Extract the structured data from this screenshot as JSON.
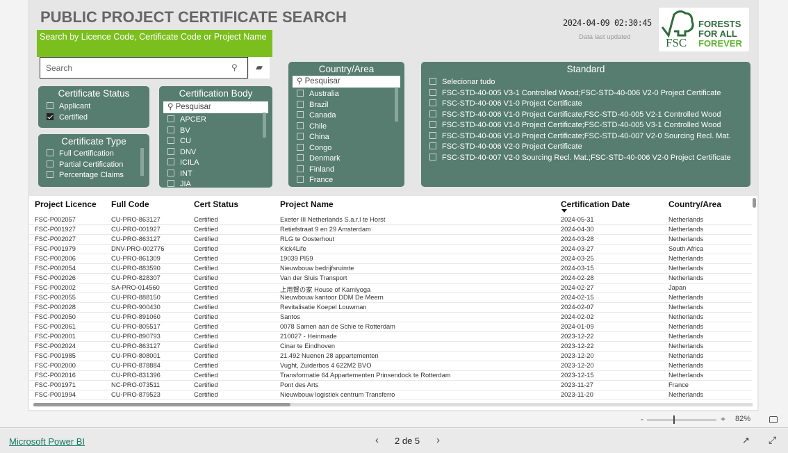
{
  "header": {
    "title": "PUBLIC PROJECT CERTIFICATE SEARCH",
    "search_label": "Search by Licence Code, Certificate Code or Project Name",
    "search_placeholder": "Search",
    "timestamp": "2024-04-09 02:30:45",
    "timestamp_label": "Data last updated",
    "logo": {
      "text1": "FORESTS",
      "text2": "FOR ALL",
      "text3": "FOREVER",
      "brand": "FSC",
      "tm": "™"
    }
  },
  "filters": {
    "cert_status": {
      "title": "Certificate Status",
      "items": [
        {
          "label": "Applicant",
          "checked": false
        },
        {
          "label": "Certified",
          "checked": true
        }
      ]
    },
    "cert_type": {
      "title": "Certificate Type",
      "items": [
        "Full Certification",
        "Partial Certification",
        "Percentage Claims"
      ]
    },
    "cert_body": {
      "title": "Certification Body",
      "search": "Pesquisar",
      "items": [
        "APCER",
        "BV",
        "CU",
        "DNV",
        "ICILA",
        "INT",
        "JIA"
      ]
    },
    "country": {
      "title": "Country/Area",
      "search": "Pesquisar",
      "items": [
        "Australia",
        "Brazil",
        "Canada",
        "Chile",
        "China",
        "Congo",
        "Denmark",
        "Finland",
        "France"
      ]
    },
    "standard": {
      "title": "Standard",
      "items": [
        "Selecionar tudo",
        "FSC-STD-40-005 V3-1 Controlled Wood;FSC-STD-40-006 V2-0 Project Certificate",
        "FSC-STD-40-006 V1-0 Project Certificate",
        "FSC-STD-40-006 V1-0 Project Certificate;FSC-STD-40-005 V2-1 Controlled Wood",
        "FSC-STD-40-006 V1-0 Project Certificate;FSC-STD-40-005 V3-1 Controlled Wood",
        "FSC-STD-40-006 V1-0 Project Certificate;FSC-STD-40-007 V2-0 Sourcing Recl. Mat.",
        "FSC-STD-40-006 V2-0 Project Certificate",
        "FSC-STD-40-007 V2-0 Sourcing Recl. Mat.;FSC-STD-40-006 V2-0 Project Certificate"
      ]
    }
  },
  "table": {
    "columns": [
      "Project Licence",
      "Full Code",
      "Cert Status",
      "Project Name",
      "Certification Date",
      "Country/Area"
    ],
    "sort_column": "Certification Date",
    "sort_dir": "desc",
    "rows": [
      [
        "FSC-P002057",
        "CU-PRO-863127",
        "Certified",
        "Exeter III Netherlands S.a.r.l te Horst",
        "2024-05-31",
        "Netherlands"
      ],
      [
        "FSC-P001927",
        "CU-PRO-001927",
        "Certified",
        "Retiefstraat 9 en 29 Amsterdam",
        "2024-04-30",
        "Netherlands"
      ],
      [
        "FSC-P002027",
        "CU-PRO-863127",
        "Certified",
        "RLG te Oosterhout",
        "2024-03-28",
        "Netherlands"
      ],
      [
        "FSC-P001979",
        "DNV-PRO-002776",
        "Certified",
        "Kick4Life",
        "2024-03-27",
        "South Africa"
      ],
      [
        "FSC-P002006",
        "CU-PRO-861309",
        "Certified",
        "19039 PI59",
        "2024-03-25",
        "Netherlands"
      ],
      [
        "FSC-P002054",
        "CU-PRO-883590",
        "Certified",
        "Nieuwbouw bedrijfsruimte",
        "2024-03-15",
        "Netherlands"
      ],
      [
        "FSC-P002026",
        "CU-PRO-828307",
        "Certified",
        "Van der Sluis Transport",
        "2024-02-28",
        "Netherlands"
      ],
      [
        "FSC-P002002",
        "SA-PRO-014560",
        "Certified",
        "上用賀の家 House of Kamiyoga",
        "2024-02-27",
        "Japan"
      ],
      [
        "FSC-P002055",
        "CU-PRO-888150",
        "Certified",
        "Nieuwbouw kantoor DDM De Meern",
        "2024-02-15",
        "Netherlands"
      ],
      [
        "FSC-P002028",
        "CU-PRO-900430",
        "Certified",
        "Revitalisatie Koepel Louwman",
        "2024-02-07",
        "Netherlands"
      ],
      [
        "FSC-P002050",
        "CU-PRO-891060",
        "Certified",
        "Santos",
        "2024-02-02",
        "Netherlands"
      ],
      [
        "FSC-P002061",
        "CU-PRO-805517",
        "Certified",
        "0078 Samen aan de Schie te Rotterdam",
        "2024-01-09",
        "Netherlands"
      ],
      [
        "FSC-P002001",
        "CU-PRO-890793",
        "Certified",
        "210027 - Heinmade",
        "2023-12-22",
        "Netherlands"
      ],
      [
        "FSC-P002024",
        "CU-PRO-863127",
        "Certified",
        "Cinar te Eindhoven",
        "2023-12-22",
        "Netherlands"
      ],
      [
        "FSC-P001985",
        "CU-PRO-808001",
        "Certified",
        "21.492 Nuenen 28 appartementen",
        "2023-12-20",
        "Netherlands"
      ],
      [
        "FSC-P002000",
        "CU-PRO-878884",
        "Certified",
        "Vught, Zuiderbos 4 622M2 BVO",
        "2023-12-20",
        "Netherlands"
      ],
      [
        "FSC-P002016",
        "CU-PRO-831396",
        "Certified",
        "Transformatie 64 Appartementen Prinsendock te Rotterdam",
        "2023-12-15",
        "Netherlands"
      ],
      [
        "FSC-P001971",
        "NC-PRO-073511",
        "Certified",
        "Pont des Arts",
        "2023-11-27",
        "France"
      ],
      [
        "FSC-P001994",
        "CU-PRO-879523",
        "Certified",
        "Nieuwbouw logistiek centrum Transferro",
        "2023-11-20",
        "Netherlands"
      ]
    ]
  },
  "zoom": {
    "minus": "-",
    "plus": "+",
    "level": "82%",
    "percent": 82
  },
  "footer": {
    "brand_link": "Microsoft Power BI",
    "page": "2 de 5"
  },
  "colors": {
    "panel": "#577d70",
    "accent": "#7bbf1f",
    "fsc_green": "#2e6b3a"
  }
}
